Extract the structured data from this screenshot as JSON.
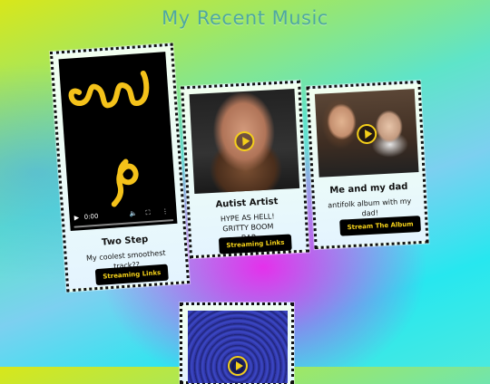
{
  "header": {
    "title": "My Recent Music"
  },
  "cards": [
    {
      "title": "Two Step",
      "description": "My coolest smoothest track??",
      "button": "Streaming Links",
      "player": {
        "time": "0:00",
        "play_icon": "play-icon",
        "volume_icon": "volume-icon",
        "fullscreen_icon": "fullscreen-icon",
        "menu_icon": "more-vert-icon"
      }
    },
    {
      "title": "Autist Artist",
      "description": "HYPE AS HELL! GRITTY BOOM BAP",
      "button": "Streaming Links"
    },
    {
      "title": "Me and my dad",
      "description": "antifolk album with my dad!",
      "button": "Stream The Album"
    },
    {
      "title": "",
      "description": "",
      "button": ""
    }
  ],
  "colors": {
    "accent": "#f4cf1a",
    "title": "#4fa8a0",
    "button_bg": "#000000"
  }
}
